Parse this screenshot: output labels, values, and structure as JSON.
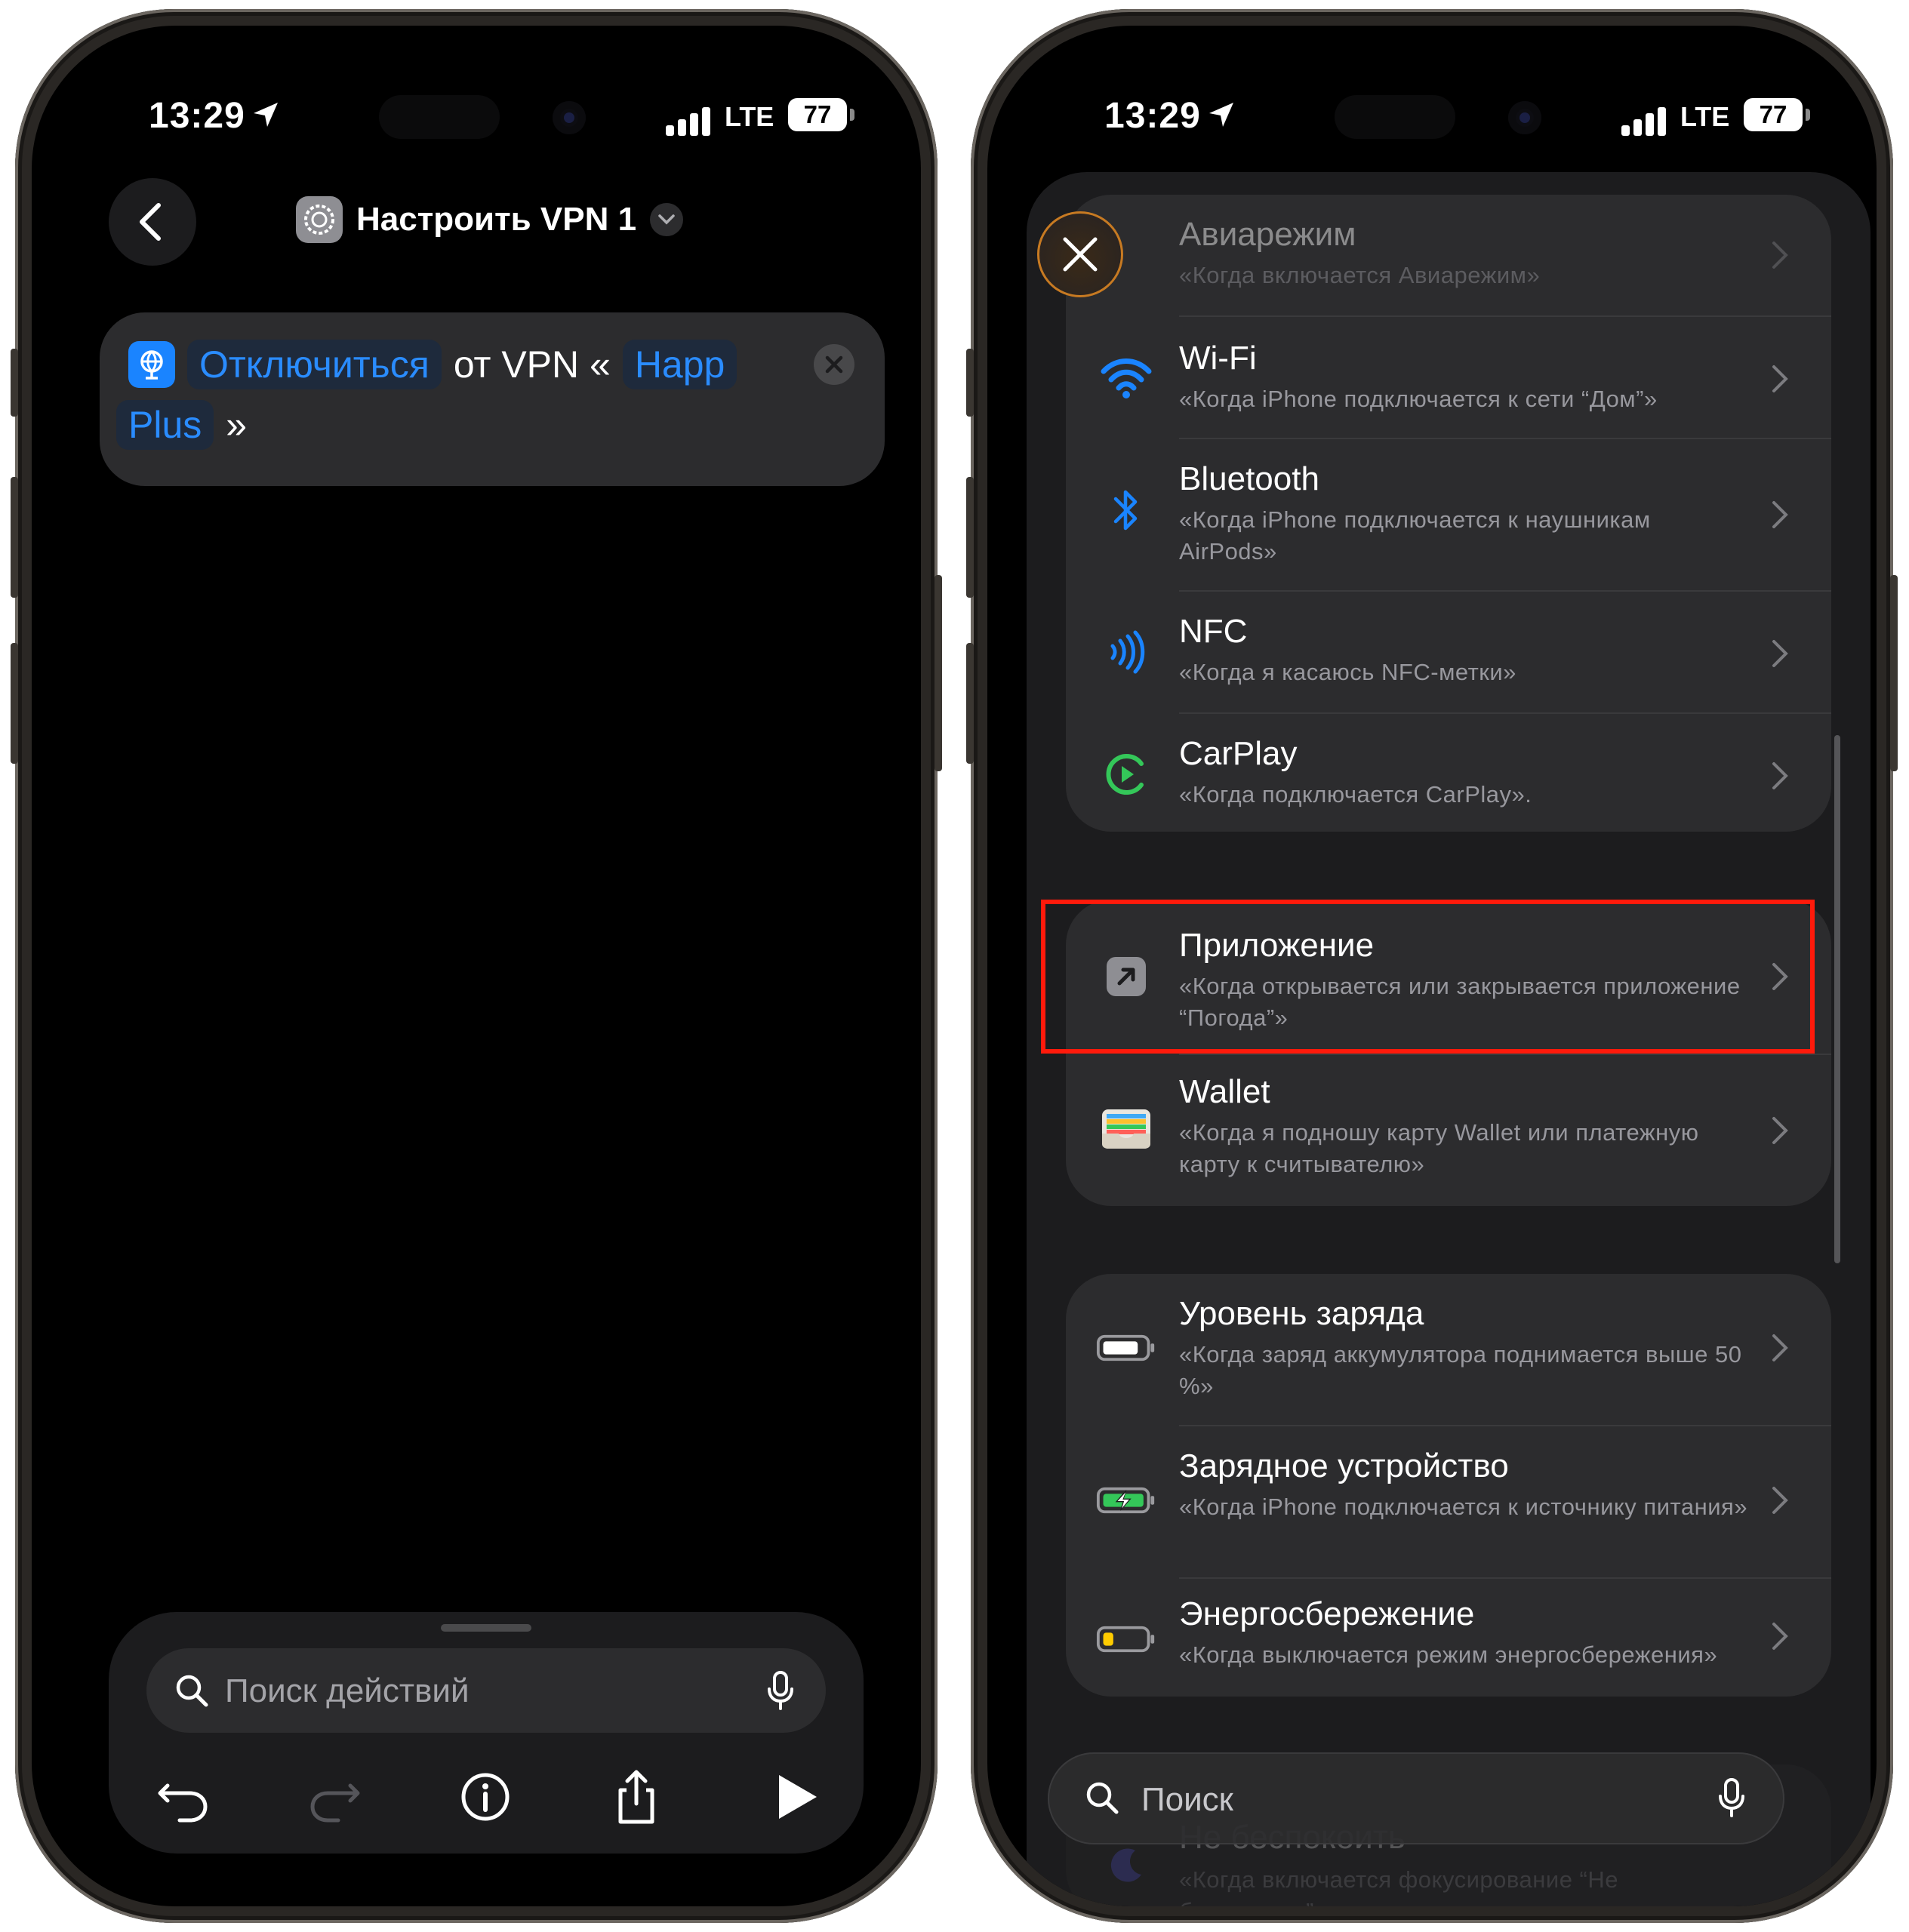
{
  "left_phone": {
    "status": {
      "time": "13:29",
      "network": "LTE",
      "battery": "77"
    },
    "header": {
      "title": "Настроить VPN 1"
    },
    "action": {
      "verb": "Отключиться",
      "text_from": "от VPN «",
      "target_part1": "Happ",
      "target_part2": "Plus",
      "close_quote": "»"
    },
    "search": {
      "placeholder": "Поиск действий"
    },
    "toolbar": [
      "undo-icon",
      "redo-icon",
      "info-icon",
      "share-icon",
      "play-icon"
    ]
  },
  "right_phone": {
    "status": {
      "time": "13:29",
      "network": "LTE",
      "battery": "77"
    },
    "group1": [
      {
        "title": "Авиарежим",
        "subtitle": "«Когда включается Авиарежим»",
        "icon": "airplane-icon"
      },
      {
        "title": "Wi-Fi",
        "subtitle": "«Когда iPhone подключается к сети “Дом”»",
        "icon": "wifi-icon",
        "color": "#1a84ff"
      },
      {
        "title": "Bluetooth",
        "subtitle": "«Когда iPhone подключается к наушникам AirPods»",
        "icon": "bluetooth-icon",
        "color": "#1a84ff"
      },
      {
        "title": "NFC",
        "subtitle": "«Когда я касаюсь NFC-метки»",
        "icon": "nfc-icon",
        "color": "#1a84ff"
      },
      {
        "title": "CarPlay",
        "subtitle": "«Когда подключается CarPlay».",
        "icon": "carplay-icon",
        "color": "#34c759"
      }
    ],
    "group2": [
      {
        "title": "Приложение",
        "subtitle": "«Когда открывается или закрывается приложение “Погода”»",
        "icon": "app-icon"
      },
      {
        "title": "Wallet",
        "subtitle": "«Когда я подношу карту Wallet или платежную карту к считывателю»",
        "icon": "wallet-icon"
      }
    ],
    "group3": [
      {
        "title": "Уровень заряда",
        "subtitle": "«Когда заряд аккумулятора поднимается выше 50 %»",
        "icon": "battery-level-icon"
      },
      {
        "title": "Зарядное устройство",
        "subtitle": "«Когда iPhone подключается к источнику питания»",
        "icon": "charger-icon",
        "color": "#34c759"
      },
      {
        "title": "Энергосбережение",
        "subtitle": "«Когда выключается режим энергосбережения»",
        "icon": "low-power-icon",
        "color": "#ffcc00"
      }
    ],
    "partial_row": {
      "title": "Не беспокоить",
      "subtitle": "«Когда включается фокусирование “Не беспокоить”»"
    },
    "search": {
      "placeholder": "Поиск"
    },
    "highlight_color": "#ff1a0b"
  }
}
